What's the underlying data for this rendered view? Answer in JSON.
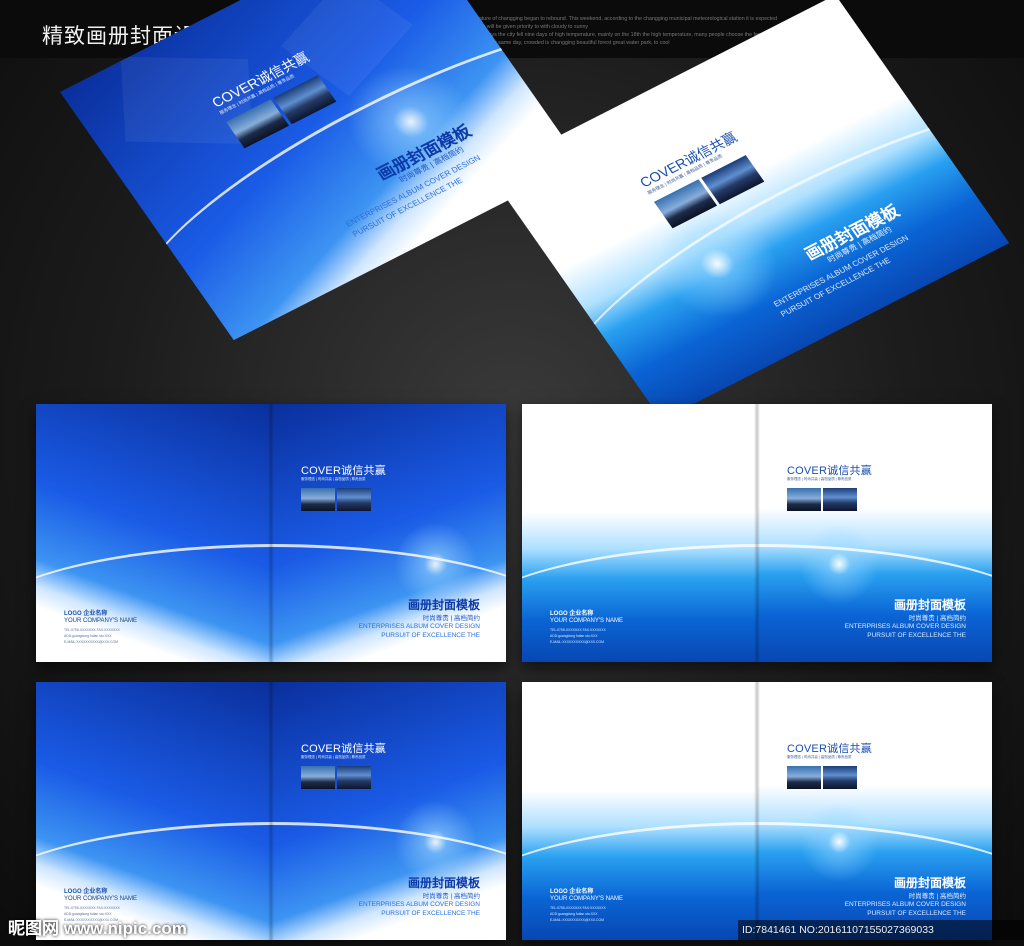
{
  "headline": "精致画册封面设计 高清PSD精细分层",
  "description_lines": [
    "he temperature of changging began to rebound. This weekend, according to the changging municipal meteorological station it is expected",
    "to changging will be given priority to with cloudy to sunny",
    "up to 5 to 11 days the city fell nine days of high temperature, mainly on the 18th the high temperature, many people choose the few in the swim",
    "ming pool. On the same day, crowded is changging beautiful forest great water park, to cool"
  ],
  "cover": {
    "brand": "COVER诚信共赢",
    "subline": "服务理念 | 时尚共赢 | 高档品质 | 尊贵品质",
    "title": "画册封面模板",
    "tagline": "时尚尊贵 | 高档简约",
    "en_line1": "ENTERPRISES ALBUM COVER DESIGN",
    "en_line2": "PURSUIT OF EXCELLENCE THE"
  },
  "back": {
    "logo": "LOGO 企业名称",
    "company": "YOUR COMPANY'S NAME",
    "contact": [
      "TEL:0755-XXXXXXX FAX:XXXXXXX",
      "ADD:guangdong futian stu:XXX",
      "E-MAIL:XXXXXXXXXX@XXX.COM"
    ]
  },
  "colors": {
    "deep_blue": "#0a2f9c",
    "bright_blue": "#1a5be6",
    "sky_blue": "#29a0f0"
  },
  "watermark": {
    "brand": "昵图网 www.nipic.com",
    "id": "ID:7841461 NO:20161107155027369033"
  }
}
